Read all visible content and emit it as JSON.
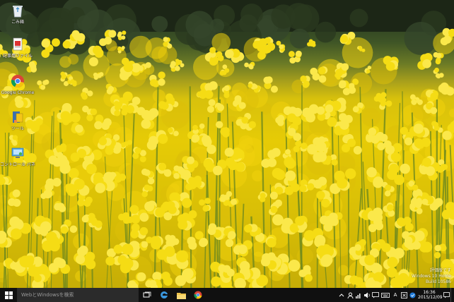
{
  "desktop": {
    "icons": [
      {
        "name": "recycle-bin-icon",
        "label": "ごみ箱"
      },
      {
        "name": "document-shortcut-icon",
        "label": "記事用ファイル"
      },
      {
        "name": "google-chrome-icon",
        "label": "Google Chrome"
      },
      {
        "name": "folder-shortcut-icon",
        "label": "ツール"
      },
      {
        "name": "control-panel-icon",
        "label": "コントロール パネル"
      }
    ]
  },
  "watermark": {
    "line1": "評価版です",
    "line2": "Windows 10 Home",
    "line3": "Build 10586"
  },
  "taskbar": {
    "search_placeholder": "WebとWindowsを検索",
    "apps": [
      "task-view-icon",
      "edge-icon",
      "file-explorer-icon",
      "chrome-icon"
    ],
    "tray": {
      "input_indicator": "A",
      "time": "16:36",
      "date": "2015/12/09"
    }
  },
  "colors": {
    "taskbar": "#101010",
    "search_box": "#2b2b2b",
    "flower_yellow": "#f2d40a"
  }
}
